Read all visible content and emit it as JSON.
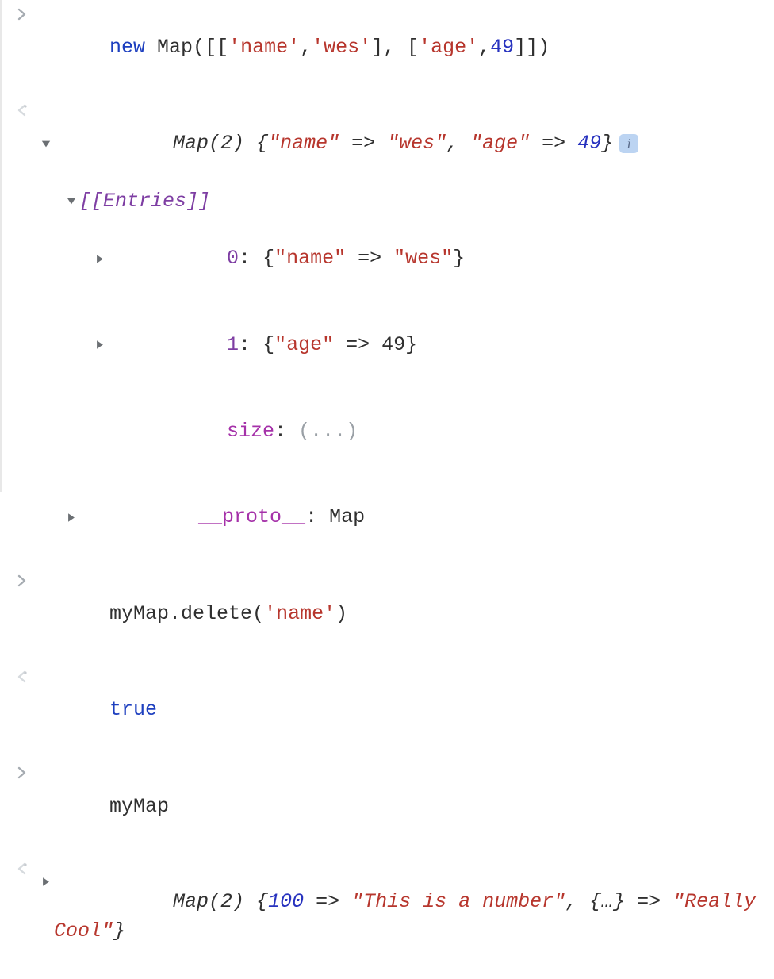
{
  "entries": [
    {
      "type": "input",
      "tokens": [
        {
          "kind": "kw-new",
          "text": "new"
        },
        {
          "kind": "space",
          "text": " "
        },
        {
          "kind": "cls",
          "text": "Map"
        },
        {
          "kind": "punct",
          "text": "([["
        },
        {
          "kind": "str",
          "text": "'name'"
        },
        {
          "kind": "punct",
          "text": ","
        },
        {
          "kind": "str",
          "text": "'wes'"
        },
        {
          "kind": "punct",
          "text": "], ["
        },
        {
          "kind": "str",
          "text": "'age'"
        },
        {
          "kind": "punct",
          "text": ","
        },
        {
          "kind": "num",
          "text": "49"
        },
        {
          "kind": "punct",
          "text": "]])"
        }
      ]
    },
    {
      "type": "output-object",
      "summary": {
        "prefix": "Map(2)",
        "body": [
          {
            "kind": "punct",
            "text": " {"
          },
          {
            "kind": "str",
            "text": "\"name\""
          },
          {
            "kind": "arrow",
            "text": " => "
          },
          {
            "kind": "str",
            "text": "\"wes\""
          },
          {
            "kind": "punct",
            "text": ", "
          },
          {
            "kind": "str",
            "text": "\"age\""
          },
          {
            "kind": "arrow",
            "text": " => "
          },
          {
            "kind": "num",
            "text": "49"
          },
          {
            "kind": "punct",
            "text": "}"
          }
        ]
      },
      "expanded": {
        "entries_label": "[[Entries]]",
        "items": [
          {
            "index": "0",
            "body": [
              {
                "kind": "punct",
                "text": "{"
              },
              {
                "kind": "str",
                "text": "\"name\""
              },
              {
                "kind": "arrow",
                "text": " => "
              },
              {
                "kind": "str",
                "text": "\"wes\""
              },
              {
                "kind": "punct",
                "text": "}"
              }
            ]
          },
          {
            "index": "1",
            "body": [
              {
                "kind": "punct",
                "text": "{"
              },
              {
                "kind": "str",
                "text": "\"age\""
              },
              {
                "kind": "arrow",
                "text": " => "
              },
              {
                "kind": "punct",
                "text": "49}"
              }
            ]
          }
        ],
        "size_label": "size",
        "size_value": "(...)",
        "proto_label": "__proto__",
        "proto_value": "Map"
      }
    },
    {
      "type": "input",
      "tokens": [
        {
          "kind": "cls",
          "text": "myMap.delete("
        },
        {
          "kind": "str",
          "text": "'name'"
        },
        {
          "kind": "cls",
          "text": ")"
        }
      ]
    },
    {
      "type": "output-simple",
      "tokens": [
        {
          "kind": "bool",
          "text": "true"
        }
      ]
    },
    {
      "type": "input",
      "tokens": [
        {
          "kind": "cls",
          "text": "myMap"
        }
      ]
    },
    {
      "type": "output-collapsed",
      "summary": {
        "prefix": "Map(2)",
        "body": [
          {
            "kind": "punct",
            "text": " {"
          },
          {
            "kind": "num",
            "text": "100"
          },
          {
            "kind": "arrow",
            "text": " => "
          },
          {
            "kind": "str",
            "text": "\"This is a number\""
          },
          {
            "kind": "punct",
            "text": ", {…}"
          },
          {
            "kind": "arrow",
            "text": " => "
          },
          {
            "kind": "str",
            "text": "\"Really Cool\""
          },
          {
            "kind": "punct",
            "text": "}"
          }
        ]
      }
    }
  ],
  "info_icon_label": "i"
}
